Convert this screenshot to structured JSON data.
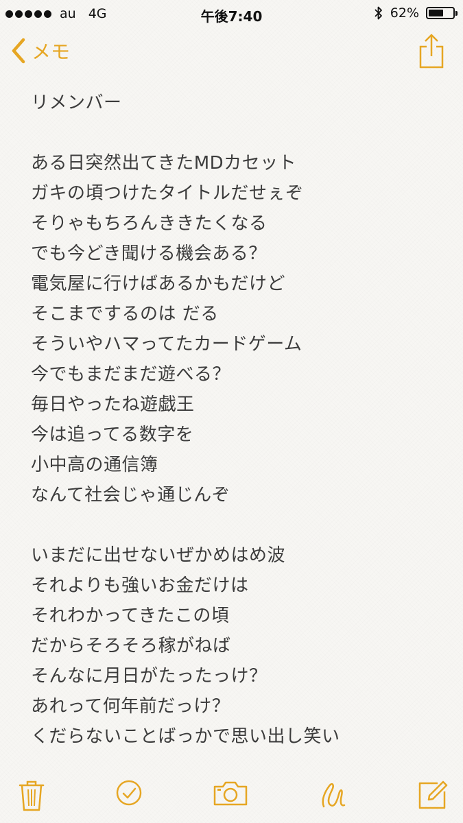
{
  "status_bar": {
    "carrier": "au",
    "network": "4G",
    "time": "午後7:40",
    "battery_text": "62%",
    "battery_level": 0.62,
    "signal_bars": 5
  },
  "nav": {
    "back_label": "メモ"
  },
  "note": {
    "lines": [
      "リメンバー",
      "",
      "ある日突然出てきたMDカセット",
      "ガキの頃つけたタイトルだせぇぞ",
      "そりゃもちろんききたくなる",
      "でも今どき聞ける機会ある？",
      "電気屋に行けばあるかもだけど",
      "そこまでするのは だる",
      "そういやハマってたカードゲーム",
      "今でもまだまだ遊べる？",
      "毎日やったね遊戯王",
      "今は追ってる数字を",
      "小中高の通信簿",
      "なんて社会じゃ通じんぞ",
      "",
      "いまだに出せないぜかめはめ波",
      "それよりも強いお金だけは",
      "それわかってきたこの頃",
      "だからそろそろ稼がねば",
      "そんなに月日がたったっけ？",
      "あれって何年前だっけ？",
      "くだらないことばっかで思い出し笑い"
    ]
  },
  "colors": {
    "accent": "#e6a623",
    "text": "#3c3c3c",
    "background": "#f7f6f3"
  },
  "toolbar": {
    "icons": [
      "trash-icon",
      "checklist-icon",
      "camera-icon",
      "sketch-icon",
      "compose-icon"
    ]
  }
}
